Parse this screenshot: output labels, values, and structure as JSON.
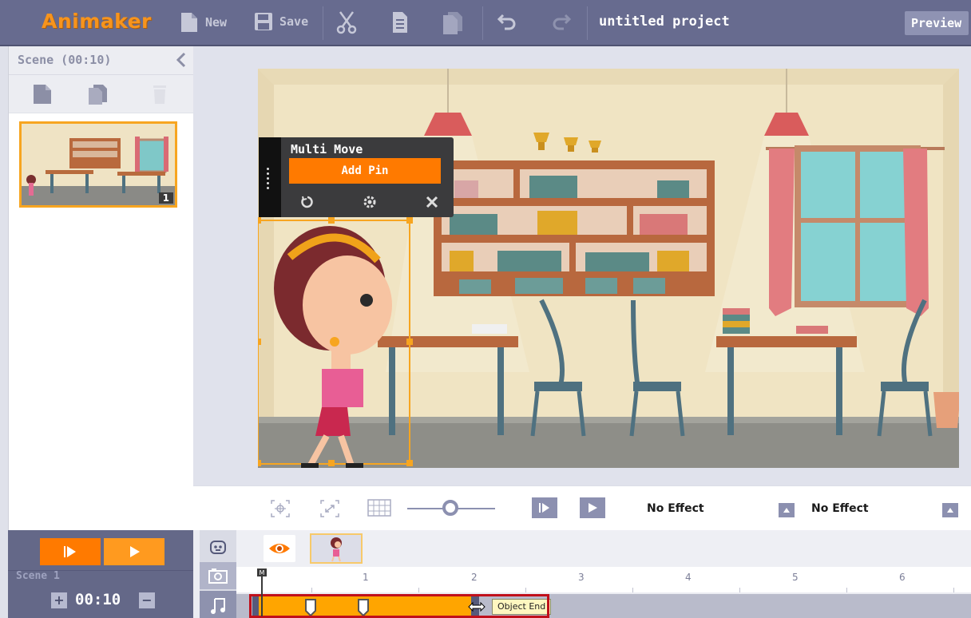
{
  "app": {
    "logo": "Animaker",
    "project_title": "untitled project",
    "preview_label": "Preview"
  },
  "toolbar": {
    "new_label": "New",
    "save_label": "Save",
    "icons": [
      "new-file-icon",
      "save-disk-icon",
      "cut-scissors-icon",
      "copy-icon",
      "paste-icon",
      "undo-icon",
      "redo-icon"
    ]
  },
  "scene_panel": {
    "title": "Scene  (00:10)",
    "thumb_number": "1",
    "tools": [
      "add-scene-icon",
      "duplicate-scene-icon",
      "delete-scene-icon"
    ]
  },
  "multi_move": {
    "title": "Multi Move",
    "add_pin_label": "Add Pin",
    "icons": [
      "reset-icon",
      "settings-gear-icon",
      "close-icon"
    ]
  },
  "stage_bar": {
    "enter_effect": "No Effect",
    "exit_effect": "No Effect",
    "zoom_level": 0.5
  },
  "bottom_left": {
    "scene_label": "Scene 1",
    "duration": "00:10",
    "plus": "+",
    "minus": "−"
  },
  "timeline": {
    "ticks": [
      "1",
      "2",
      "3",
      "4",
      "5",
      "6"
    ],
    "tooltip": "Object End",
    "playhead_label": "M"
  },
  "colors": {
    "topbar": "#676b8f",
    "accent_orange": "#ff7a00",
    "object_bar": "#ffa500",
    "highlight_red": "#c0101b"
  }
}
